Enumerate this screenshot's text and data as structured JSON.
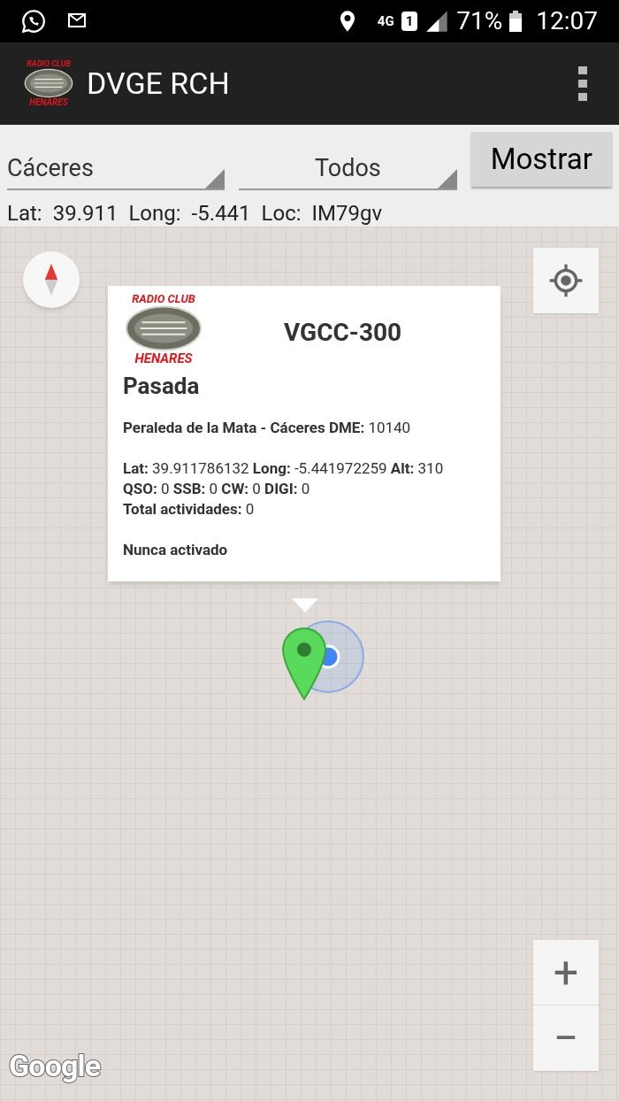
{
  "status_bar": {
    "network": "4G",
    "sim": "1",
    "battery": "71%",
    "time": "12:07"
  },
  "app_bar": {
    "logo": {
      "top": "RADIO CLUB",
      "bottom": "HENARES"
    },
    "title": "DVGE RCH"
  },
  "filters": {
    "province": "Cáceres",
    "type": "Todos",
    "button": "Mostrar"
  },
  "position": [
    {
      "label": "Lat:",
      "value": "39.911"
    },
    {
      "label": "Long:",
      "value": "-5.441"
    },
    {
      "label": "Loc:",
      "value": "IM79gv"
    }
  ],
  "popup": {
    "logo": {
      "top": "RADIO CLUB",
      "bottom": "HENARES"
    },
    "code": "VGCC-300",
    "status": "Pasada",
    "paragraphs": [
      [
        "**Peraleda de la Mata - Cáceres DME:** 10140"
      ],
      [
        "**Lat:** 39.911786132 **Long:** -5.441972259 **Alt:** 310",
        "**QSO:** 0 **SSB:** 0 **CW:** 0 **DIGI:** 0",
        "**Total actividades:** 0"
      ],
      [
        "**Nunca activado**"
      ]
    ]
  },
  "map": {
    "zoom_in": "+",
    "zoom_out": "−",
    "attribution": "Google"
  }
}
